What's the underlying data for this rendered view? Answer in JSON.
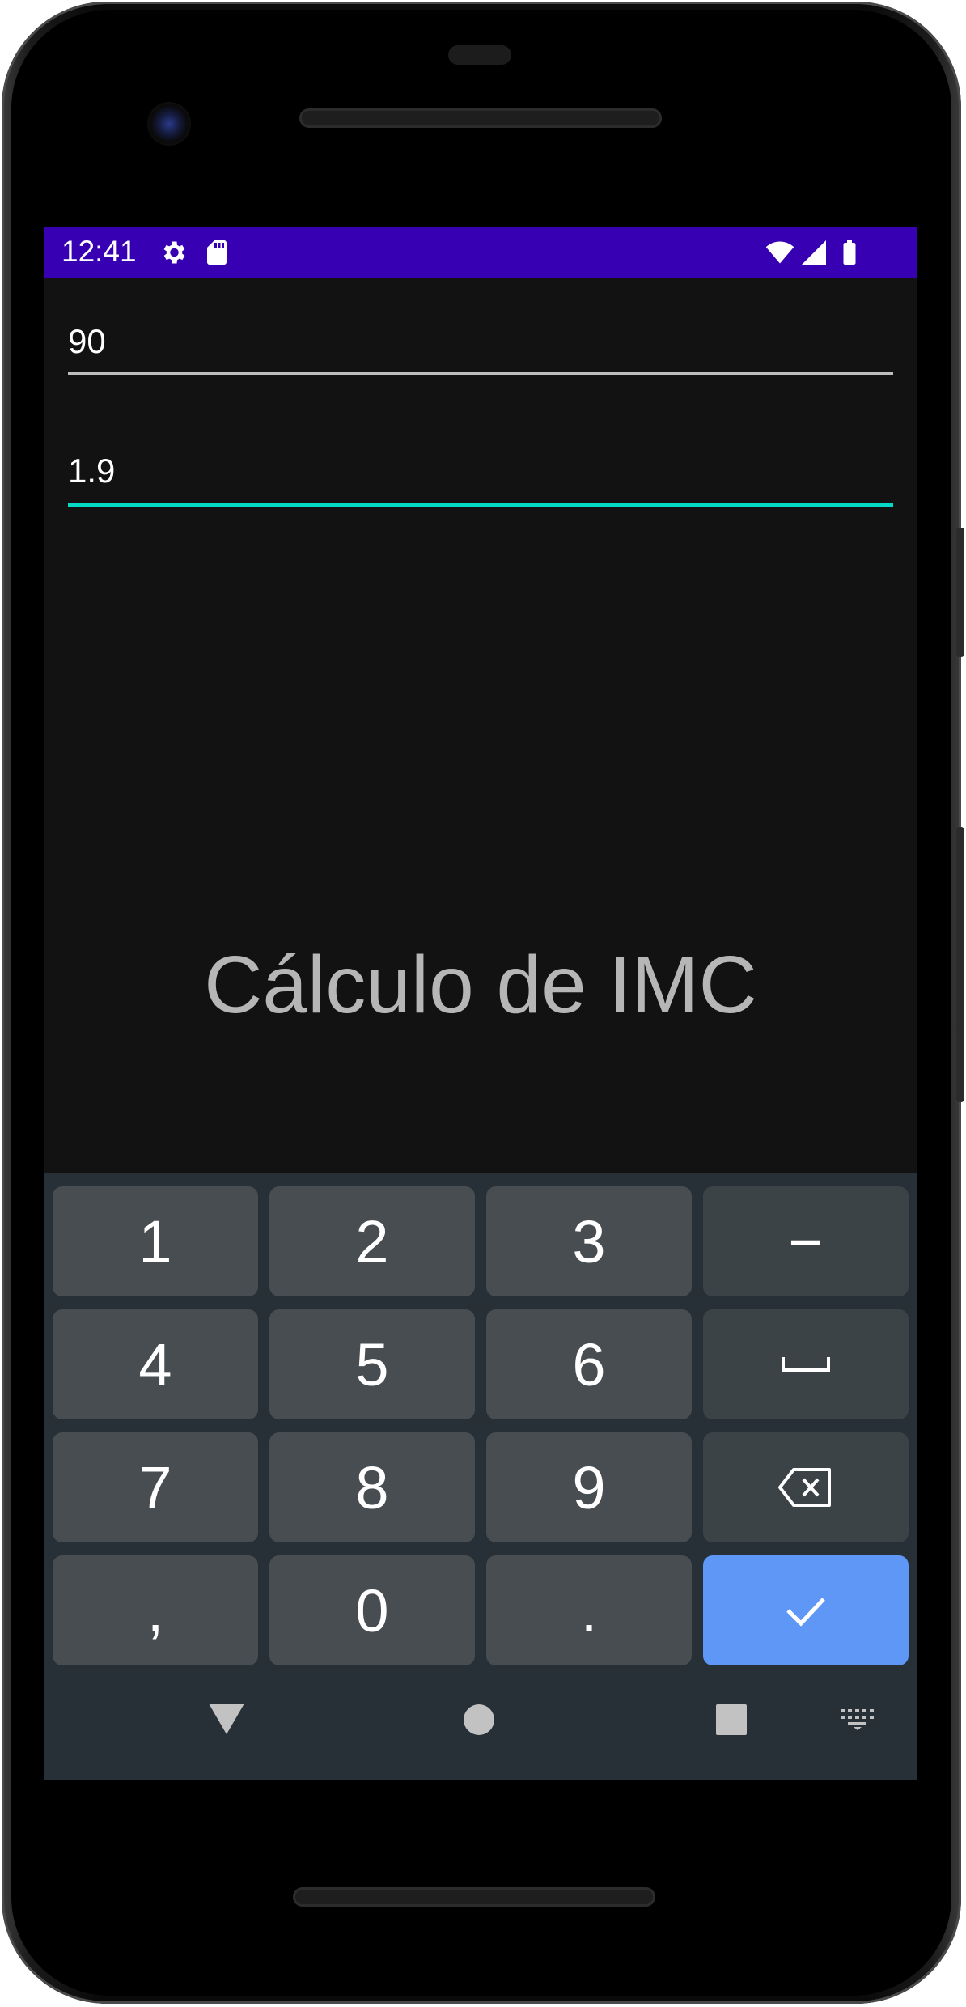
{
  "status_bar": {
    "time": "12:41",
    "left_icons": [
      "settings-gear-icon",
      "sd-card-icon"
    ],
    "right_icons": [
      "wifi-icon",
      "cell-signal-icon",
      "battery-icon"
    ],
    "color": "#3700b3"
  },
  "form": {
    "weight_value": "90",
    "height_value": "1.9",
    "focused_line_color": "#03dac5",
    "line_color": "#bdbdbd"
  },
  "title": "Cálculo de IMC",
  "keyboard": {
    "rows": [
      [
        "1",
        "2",
        "3",
        "−"
      ],
      [
        "4",
        "5",
        "6",
        "space"
      ],
      [
        "7",
        "8",
        "9",
        "backspace"
      ],
      [
        ",",
        "0",
        ".",
        "done"
      ]
    ],
    "labels": {
      "k1": "1",
      "k2": "2",
      "k3": "3",
      "minus": "−",
      "k4": "4",
      "k5": "5",
      "k6": "6",
      "k7": "7",
      "k8": "8",
      "k9": "9",
      "comma": ",",
      "k0": "0",
      "period": "."
    },
    "icons": {
      "space": "space-bar-icon",
      "backspace": "backspace-icon",
      "done": "checkmark-icon"
    },
    "enter_color": "#5e97f6"
  },
  "nav_bar": {
    "icons": [
      "back-triangle-icon",
      "home-circle-icon",
      "recents-square-icon",
      "keyboard-switch-icon"
    ]
  }
}
